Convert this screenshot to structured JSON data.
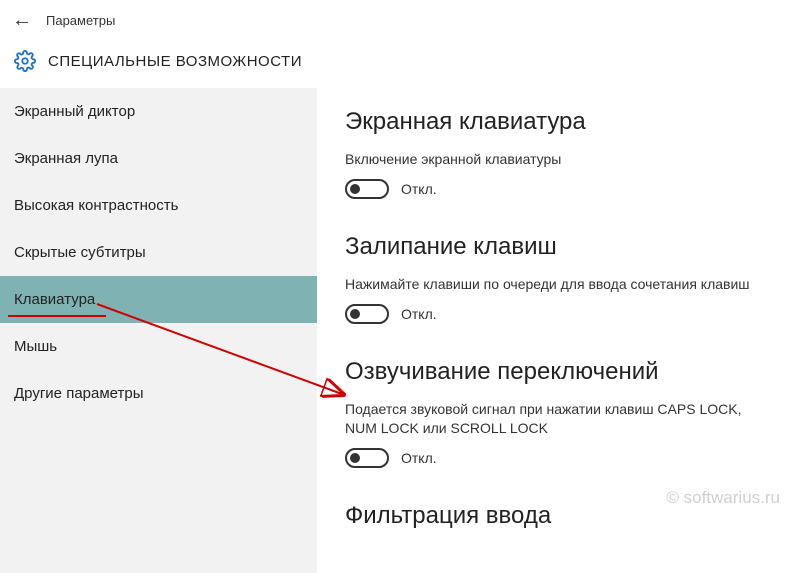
{
  "header": {
    "app_title": "Параметры",
    "category_title": "СПЕЦИАЛЬНЫЕ ВОЗМОЖНОСТИ"
  },
  "sidebar": {
    "items": [
      {
        "label": "Экранный диктор"
      },
      {
        "label": "Экранная лупа"
      },
      {
        "label": "Высокая контрастность"
      },
      {
        "label": "Скрытые субтитры"
      },
      {
        "label": "Клавиатура"
      },
      {
        "label": "Мышь"
      },
      {
        "label": "Другие параметры"
      }
    ]
  },
  "main": {
    "sections": [
      {
        "title": "Экранная клавиатура",
        "label": "Включение экранной клавиатуры",
        "state": "Откл."
      },
      {
        "title": "Залипание клавиш",
        "label": "Нажимайте клавиши по очереди для ввода сочетания клавиш",
        "state": "Откл."
      },
      {
        "title": "Озвучивание переключений",
        "label": "Подается звуковой сигнал при нажатии клавиш CAPS LOCK, NUM LOCK или SCROLL LOCK",
        "state": "Откл."
      },
      {
        "title": "Фильтрация ввода",
        "label": "",
        "state": ""
      }
    ]
  },
  "watermark": "© softwarius.ru"
}
